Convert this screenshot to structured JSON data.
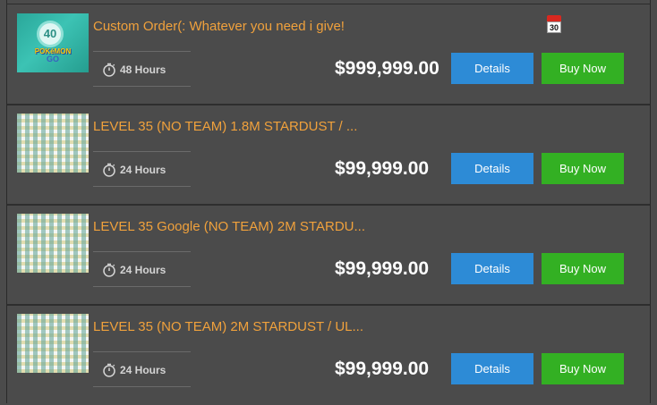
{
  "listings": [
    {
      "title": "Custom Order(: Whatever you need i give!",
      "hours": "48 Hours",
      "price": "$999,999.00",
      "details_label": "Details",
      "buy_label": "Buy Now",
      "thumb_badge": "40",
      "thumb_logo_top": "POKéMON",
      "thumb_logo_bottom": "GO",
      "calendar_day": "30"
    },
    {
      "title": "LEVEL 35 (NO TEAM) 1.8M STARDUST / ...",
      "hours": "24 Hours",
      "price": "$99,999.00",
      "details_label": "Details",
      "buy_label": "Buy Now"
    },
    {
      "title": "LEVEL 35 Google (NO TEAM) 2M STARDU...",
      "hours": "24 Hours",
      "price": "$99,999.00",
      "details_label": "Details",
      "buy_label": "Buy Now"
    },
    {
      "title": "LEVEL 35 (NO TEAM) 2M STARDUST / UL...",
      "hours": "24 Hours",
      "price": "$99,999.00",
      "details_label": "Details",
      "buy_label": "Buy Now"
    }
  ],
  "colors": {
    "background": "#4b4b4b",
    "title": "#f0a13c",
    "details_button": "#2d8bd6",
    "buy_button": "#33b023"
  },
  "icons": {
    "timer": "stopwatch-icon",
    "calendar": "calendar-icon"
  }
}
